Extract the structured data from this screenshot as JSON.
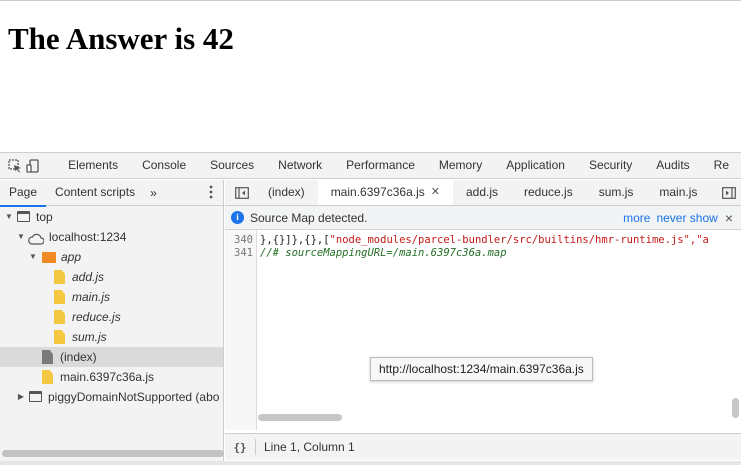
{
  "page": {
    "heading": "The Answer is 42"
  },
  "devtools": {
    "main_tabs": [
      "Elements",
      "Console",
      "Sources",
      "Network",
      "Performance",
      "Memory",
      "Application",
      "Security",
      "Audits",
      "Re"
    ],
    "active_main_tab": "Sources",
    "navigator": {
      "tabs": [
        "Page",
        "Content scripts"
      ],
      "more": "»",
      "tree": {
        "top": "top",
        "host": "localhost:1234",
        "folder": "app",
        "files": [
          "add.js",
          "main.js",
          "reduce.js",
          "sum.js"
        ],
        "index": "(index)",
        "bundle": "main.6397c36a.js",
        "frame": "piggyDomainNotSupported (abo"
      }
    },
    "editor": {
      "tabs": [
        "(index)",
        "main.6397c36a.js",
        "add.js",
        "reduce.js",
        "sum.js",
        "main.js"
      ],
      "active_tab": "main.6397c36a.js",
      "infobar": {
        "text": "Source Map detected.",
        "more": "more",
        "never_show": "never show",
        "close": "×"
      },
      "tooltip": "http://localhost:1234/main.6397c36a.js",
      "lines": [
        {
          "num": "340",
          "prefix": "},{}]},{},[",
          "str": "\"node_modules/parcel-bundler/src/builtins/hmr-runtime.js\",\"a"
        },
        {
          "num": "341",
          "comment": "//# sourceMappingURL=/main.6397c36a.map"
        }
      ],
      "status": {
        "format": "{}",
        "position": "Line 1, Column 1"
      }
    }
  },
  "colors": {
    "accent": "#1a73e8",
    "file_yellow": "#f5c842",
    "folder_orange": "#f08a24"
  },
  "icons": [
    "inspect-icon",
    "device-toggle-icon",
    "sidebar-toggle-icon",
    "debugger-toggle-icon",
    "info-icon",
    "cloud-icon",
    "folder-icon",
    "file-icon",
    "frame-icon"
  ]
}
